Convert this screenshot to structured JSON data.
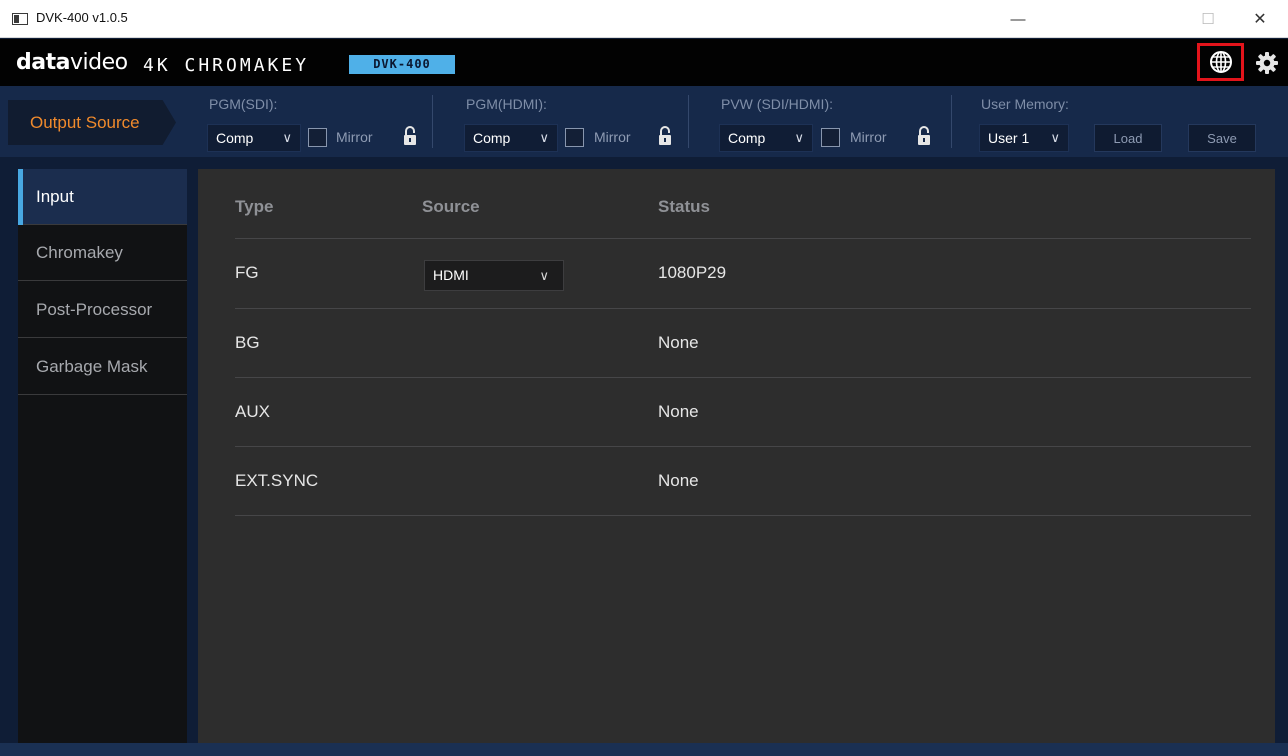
{
  "window": {
    "title": "DVK-400 v1.0.5",
    "minimize": "—",
    "maximize": "☐",
    "close": "✕"
  },
  "brand": {
    "logo_bold": "data",
    "logo_light": "video",
    "product": "4K CHROMAKEY",
    "model": "DVK-400",
    "globe_icon": "globe-icon",
    "settings_icon": "gear-icon"
  },
  "output_bar": {
    "tab_label": "Output Source",
    "groups": [
      {
        "label": "PGM(SDI):",
        "value": "Comp",
        "mirror": "Mirror",
        "mirror_checked": false
      },
      {
        "label": "PGM(HDMI):",
        "value": "Comp",
        "mirror": "Mirror",
        "mirror_checked": false
      },
      {
        "label": "PVW (SDI/HDMI):",
        "value": "Comp",
        "mirror": "Mirror",
        "mirror_checked": false
      }
    ],
    "memory": {
      "label": "User Memory:",
      "value": "User 1",
      "load": "Load",
      "save": "Save"
    }
  },
  "sidebar": {
    "items": [
      {
        "label": "Input",
        "active": true
      },
      {
        "label": "Chromakey",
        "active": false
      },
      {
        "label": "Post-Processor",
        "active": false
      },
      {
        "label": "Garbage Mask",
        "active": false
      }
    ]
  },
  "input_table": {
    "headers": {
      "type": "Type",
      "source": "Source",
      "status": "Status"
    },
    "rows": [
      {
        "type": "FG",
        "source": "HDMI",
        "status": "1080P29"
      },
      {
        "type": "BG",
        "source": "",
        "status": "None"
      },
      {
        "type": "AUX",
        "source": "",
        "status": "None"
      },
      {
        "type": "EXT.SYNC",
        "source": "",
        "status": "None"
      }
    ]
  },
  "colors": {
    "accent_orange": "#f08a2c",
    "accent_blue": "#48a8e2",
    "highlight_red": "#e3141b",
    "panel_bg": "#2d2d2d",
    "bar_bg": "#16294a"
  }
}
